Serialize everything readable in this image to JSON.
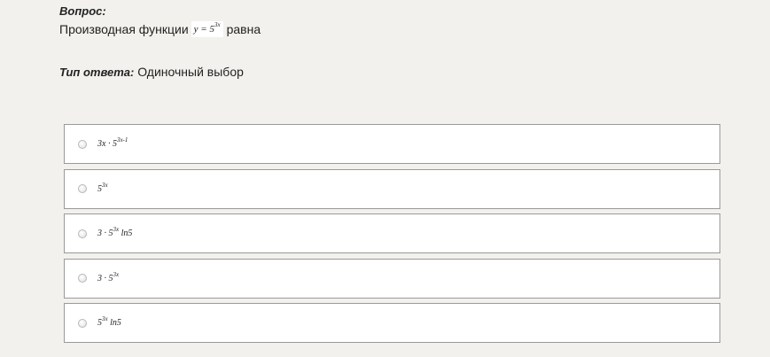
{
  "question": {
    "label": "Вопрос:",
    "text_before": "Производная функции",
    "formula": {
      "base": "y = 5",
      "exp": "3x"
    },
    "text_after": "равна"
  },
  "answer_type": {
    "label": "Тип ответа:",
    "value": "Одиночный выбор"
  },
  "options": [
    {
      "pre": "3x · 5",
      "exp": "3x-1",
      "post": ""
    },
    {
      "pre": "5",
      "exp": "3x",
      "post": ""
    },
    {
      "pre": "3 · 5",
      "exp": "3x",
      "post": " ln5"
    },
    {
      "pre": "3 · 5",
      "exp": "3x",
      "post": ""
    },
    {
      "pre": "5",
      "exp": "3x",
      "post": " ln5"
    }
  ]
}
